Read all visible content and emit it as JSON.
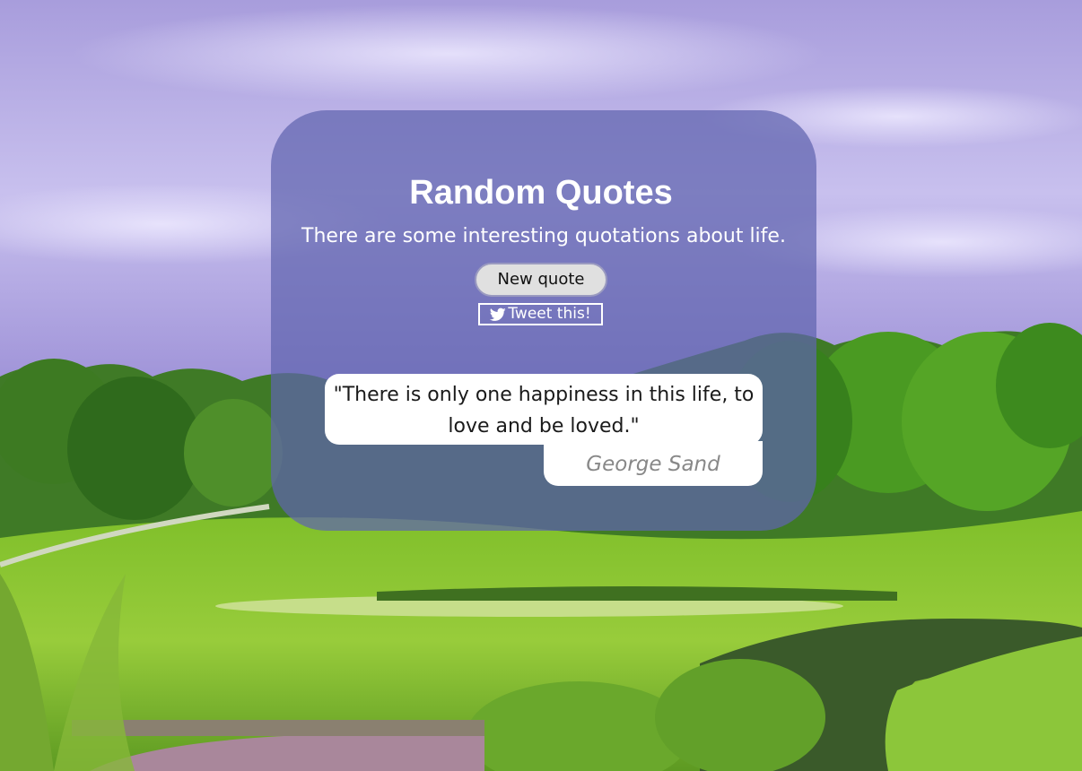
{
  "header": {
    "title": "Random Quotes",
    "subtitle": "There are some interesting quotations about life."
  },
  "actions": {
    "new_quote_label": "New quote",
    "tweet_label": "Tweet this!",
    "tweet_icon": "twitter-bird-icon"
  },
  "quote": {
    "text": "\"There is only one happiness in this life, to love and be loved.\"",
    "author": "George Sand"
  },
  "colors": {
    "card_overlay": "#5f64af",
    "quote_bg": "#ffffff",
    "author_text": "#888888",
    "sky": "#9d8fd6",
    "grass": "#8cc63a"
  }
}
